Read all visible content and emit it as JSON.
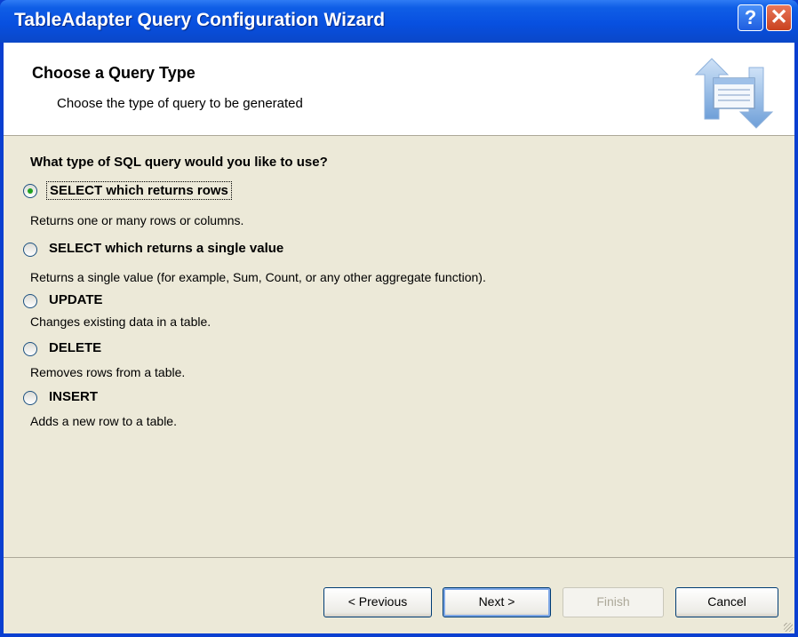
{
  "window": {
    "title": "TableAdapter Query Configuration Wizard",
    "help_glyph": "?",
    "close_glyph": "✕"
  },
  "header": {
    "title": "Choose a Query Type",
    "subtitle": "Choose the type of query to be generated",
    "icon": "wizard-transfer-icon"
  },
  "main": {
    "question": "What type of SQL query would you like to use?",
    "options": [
      {
        "label": "SELECT which returns rows",
        "description": "Returns one or many rows or columns.",
        "selected": true
      },
      {
        "label": "SELECT which returns a single value",
        "description": "Returns a single value (for example, Sum, Count, or any other aggregate function).",
        "selected": false
      },
      {
        "label": "UPDATE",
        "description": "Changes existing data in a table.",
        "selected": false
      },
      {
        "label": "DELETE",
        "description": "Removes rows from a table.",
        "selected": false
      },
      {
        "label": "INSERT",
        "description": "Adds a new row to a table.",
        "selected": false
      }
    ]
  },
  "footer": {
    "previous_label": "< Previous",
    "next_label": "Next >",
    "finish_label": "Finish",
    "cancel_label": "Cancel"
  },
  "colors": {
    "titlebar": "#0a47c8",
    "face": "#ece9d8",
    "radio_dot": "#21a121"
  }
}
